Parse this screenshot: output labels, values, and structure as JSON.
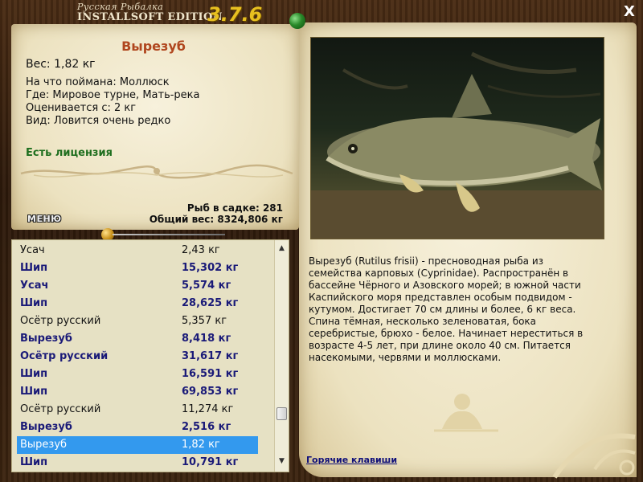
{
  "app": {
    "title_top": "Русская Рыбалка",
    "title_bottom": "INSTALLSOFT EDITION",
    "version": "3.7.6",
    "close_label": "X"
  },
  "fish": {
    "name": "Вырезуб",
    "weight": "Вес: 1,82 кг",
    "caught_with": "На что поймана: Моллюск",
    "where": "Где: Мировое турне, Мать-река",
    "rated_from": "Оценивается с: 2 кг",
    "rarity": "Вид: Ловится очень редко",
    "license": "Есть лицензия"
  },
  "stats": {
    "in_keepnet": "Рыб в садке: 281",
    "total_weight": "Общий вес: 8324,806 кг"
  },
  "menu_label": "МЕНЮ",
  "catch_list": [
    {
      "name": "Усач",
      "weight": "2,43 кг",
      "style": "normal"
    },
    {
      "name": "Шип",
      "weight": "15,302 кг",
      "style": "bold"
    },
    {
      "name": "Усач",
      "weight": "5,574 кг",
      "style": "bold"
    },
    {
      "name": "Шип",
      "weight": "28,625 кг",
      "style": "bold"
    },
    {
      "name": "Осётр русский",
      "weight": "5,357 кг",
      "style": "normal"
    },
    {
      "name": "Вырезуб",
      "weight": "8,418 кг",
      "style": "bold"
    },
    {
      "name": "Осётр русский",
      "weight": "31,617 кг",
      "style": "bold"
    },
    {
      "name": "Шип",
      "weight": "16,591 кг",
      "style": "bold"
    },
    {
      "name": "Шип",
      "weight": "69,853 кг",
      "style": "bold"
    },
    {
      "name": "Осётр русский",
      "weight": "11,274 кг",
      "style": "normal"
    },
    {
      "name": "Вырезуб",
      "weight": "2,516 кг",
      "style": "bold"
    },
    {
      "name": "Вырезуб",
      "weight": "1,82 кг",
      "style": "selected"
    },
    {
      "name": "Шип",
      "weight": "10,791 кг",
      "style": "bold"
    }
  ],
  "description_lines": [
    "Вырезуб (Rutilus frisii) - пресноводная рыба из",
    "семейства карповых (Cyprinidae). Распространён в",
    "бассейне Чёрного и Азовского морей; в южной части",
    "Каспийского моря представлен особым подвидом -",
    "кутумом. Достигает 70 см длины и более, 6 кг веса.",
    "Спина тёмная, несколько зеленоватая, бока",
    "серебристые, брюхо - белое. Начинает нереститься в",
    "возрасте 4-5 лет, при длине около 40 см. Питается",
    "насекомыми, червями и моллюсками."
  ],
  "hotkeys_label": "Горячие клавиши",
  "scrollbar": {
    "up_icon": "triangle-up-icon",
    "down_icon": "triangle-down-icon"
  },
  "colors": {
    "fish_name": "#b0461e",
    "license": "#1e6e1e",
    "selected_row": "#3399ee",
    "bold_row": "#1a1a78",
    "link": "#10107a",
    "version": "#e8c020"
  }
}
